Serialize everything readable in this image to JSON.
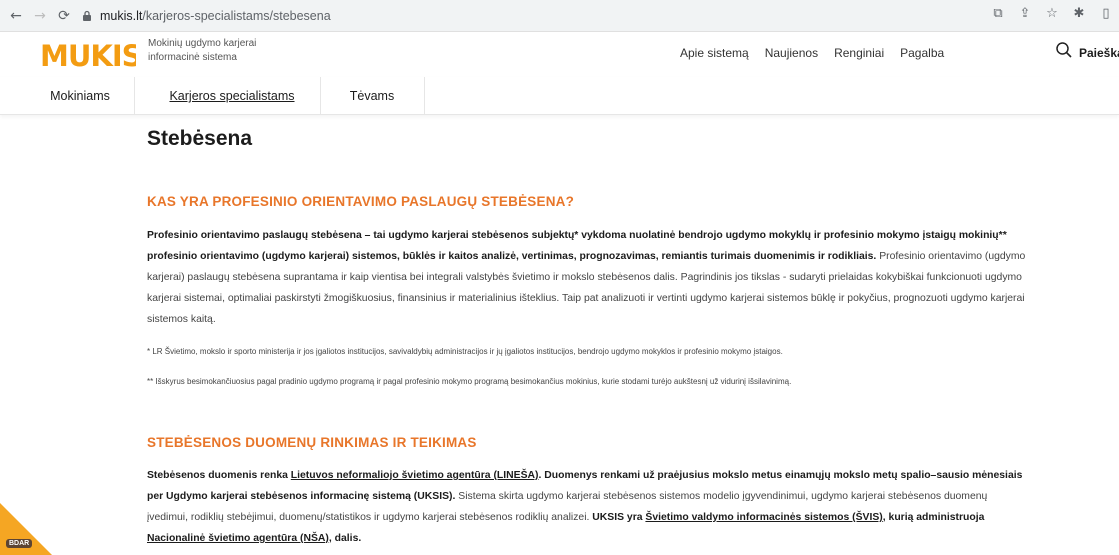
{
  "browser": {
    "url_host": "mukis.lt",
    "url_path": "/karjeros-specialistams/stebesena"
  },
  "site": {
    "logo_text": "MUKIS",
    "tagline": "Mokinių ugdymo karjerai informacinė sistema",
    "topnav": [
      "Apie sistemą",
      "Naujienos",
      "Renginiai",
      "Pagalba"
    ],
    "search_label": "Paieška"
  },
  "subnav": {
    "items": [
      "Mokiniams",
      "Karjeros specialistams",
      "Tėvams"
    ]
  },
  "page": {
    "title": "Stebėsena",
    "section1_title": "KAS YRA PROFESINIO ORIENTAVIMO PASLAUGŲ STEBĖSENA?",
    "section1_bold": "Profesinio orientavimo paslaugų stebėsena – tai ugdymo karjerai stebėsenos subjektų* vykdoma nuolatinė bendrojo ugdymo mokyklų ir profesinio mokymo įstaigų mokinių** profesinio orientavimo (ugdymo karjerai) sistemos, būklės ir kaitos analizė, vertinimas, prognozavimas, remiantis turimais duomenimis ir rodikliais.",
    "section1_text": " Profesinio orientavimo (ugdymo karjerai) paslaugų stebėsena suprantama ir kaip vientisa bei integrali valstybės švietimo ir mokslo stebėsenos dalis. Pagrindinis jos tikslas - sudaryti prielaidas kokybiškai funkcionuoti ugdymo karjerai sistemai, optimaliai paskirstyti žmogiškuosius, finansinius ir materialinius išteklius. Taip pat analizuoti ir vertinti ugdymo karjerai sistemos būklę ir pokyčius, prognozuoti ugdymo karjerai sistemos kaitą.",
    "footnote1": "* LR Švietimo, mokslo ir sporto ministerija ir jos įgaliotos institucijos, savivaldybių administracijos ir jų įgaliotos institucijos, bendrojo ugdymo mokyklos ir profesinio mokymo įstaigos.",
    "footnote2": "** Išskyrus besimokančiuosius pagal pradinio ugdymo programą ir pagal profesinio mokymo programą besimokančius mokinius, kurie stodami turėjo aukštesnį už vidurinį išsilavinimą.",
    "section2_title": "STEBĖSENOS DUOMENŲ RINKIMAS IR TEIKIMAS",
    "section2_b1": "Stebėsenos duomenis renka ",
    "section2_link1": "Lietuvos neformaliojo švietimo agentūra (LINEŠA)",
    "section2_b2": ". Duomenys renkami už praėjusius mokslo metus einamųjų mokslo metų spalio–sausio mėnesiais per Ugdymo karjerai stebėsenos informacinę sistemą (UKSIS).",
    "section2_text": " Sistema skirta ugdymo karjerai stebėsenos sistemos modelio įgyvendinimui, ugdymo karjerai stebėsenos duomenų įvedimui, rodiklių stebėjimui, duomenų/statistikos ir ugdymo karjerai stebėsenos rodiklių analizei. ",
    "section2_b3": "UKSIS yra ",
    "section2_link2": "Švietimo valdymo informacinės sistemos (ŠVIS)",
    "section2_b4": ", kurią administruoja ",
    "section2_link3": "Nacionalinė švietimo agentūra (NŠA)",
    "section2_b5": ", dalis."
  },
  "bdar": {
    "label": "BDAR"
  },
  "colors": {
    "accent": "#e8762a",
    "logo": "#f39c12"
  }
}
